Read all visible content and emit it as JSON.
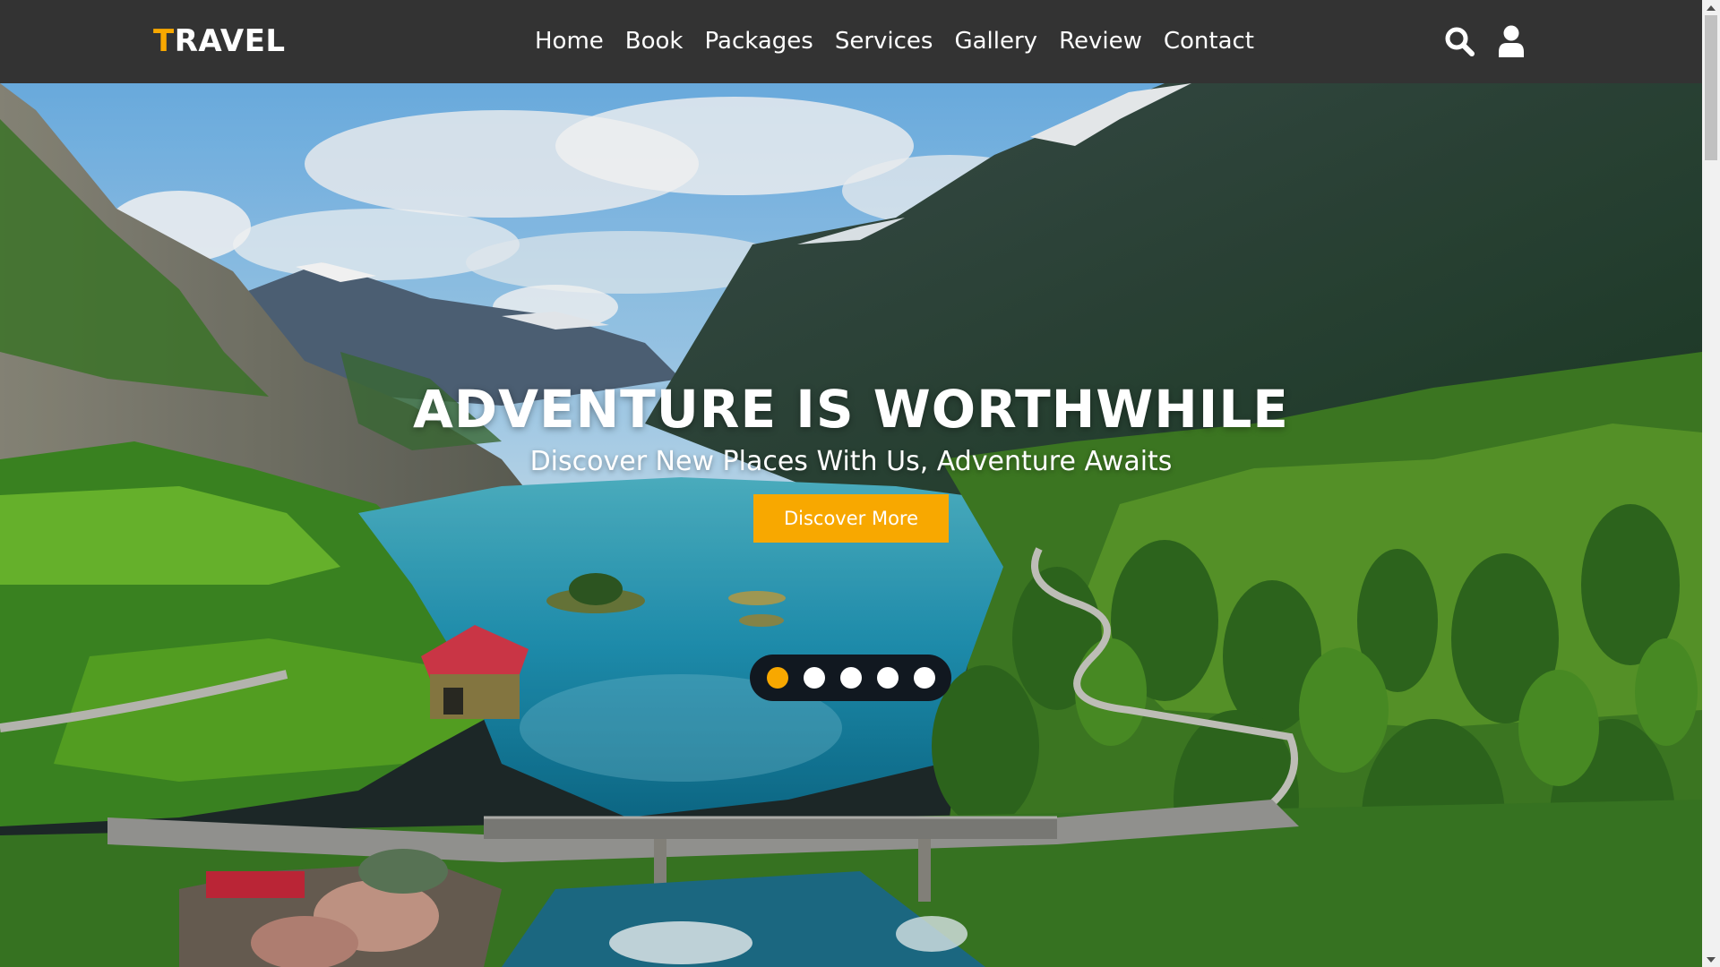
{
  "logo": {
    "first_letter": "T",
    "rest": "RAVEL"
  },
  "nav": {
    "links": [
      "Home",
      "Book",
      "Packages",
      "Services",
      "Gallery",
      "Review",
      "Contact"
    ],
    "icons": [
      "search-icon",
      "user-icon"
    ]
  },
  "hero": {
    "title": "ADVENTURE IS WORTHWHILE",
    "subtitle": "Discover New Places With Us, Adventure Awaits",
    "button_label": "Discover More",
    "slides_count": 5,
    "active_slide": 1
  },
  "colors": {
    "accent": "#f8a800",
    "navbar_bg": "#333333",
    "dots_bg": "#111820"
  }
}
